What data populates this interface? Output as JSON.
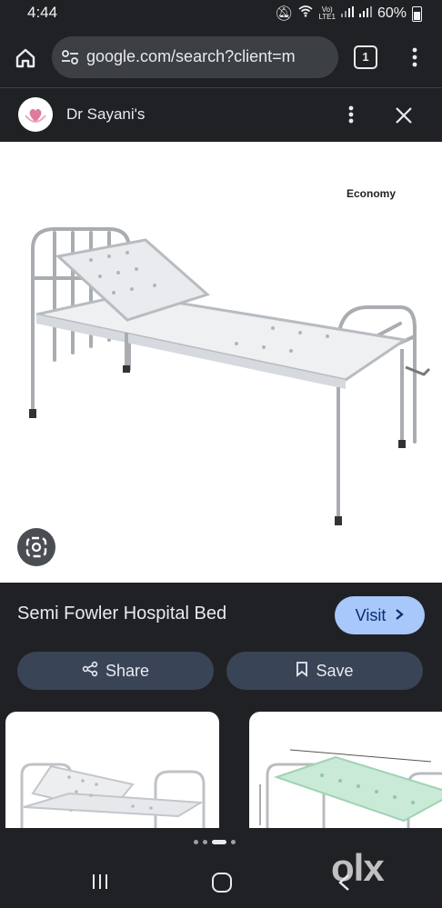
{
  "status": {
    "time": "4:44",
    "network_top": "Vo)",
    "network_bottom": "LTE1",
    "battery": "60%"
  },
  "browser": {
    "url": "google.com/search?client=m",
    "tab_count": "1"
  },
  "panel": {
    "site_name": "Dr Sayani's"
  },
  "image": {
    "label": "Economy"
  },
  "result": {
    "title": "Semi Fowler Hospital Bed",
    "visit_label": "Visit",
    "visit_icon": "chevron-right",
    "share_label": "Share",
    "save_label": "Save"
  },
  "watermark": {
    "text": "olx"
  },
  "colors": {
    "background": "#202124",
    "accent": "#a8c7fa",
    "pill": "#394457"
  }
}
